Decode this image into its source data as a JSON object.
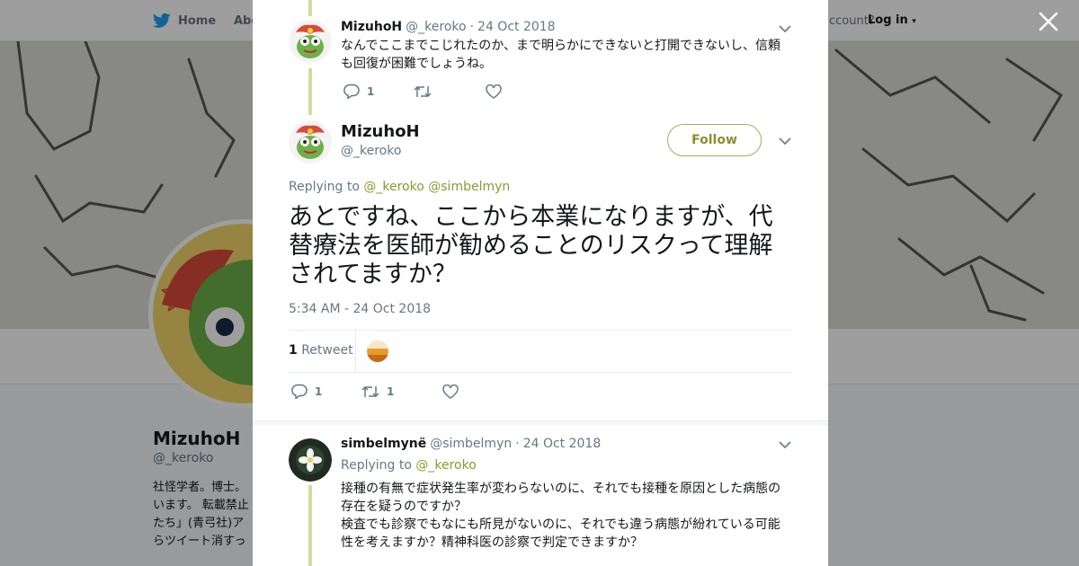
{
  "background": {
    "nav": {
      "home_label": "Home",
      "about_label": "Abo",
      "account_text": "ccount?",
      "login_label": "Log in"
    },
    "profile": {
      "name": "MizuhoH",
      "handle": "@_keroko",
      "bio": "社怪学者。博士。\nいます。 転載禁止\nたち」(青弓社)ア\nらツイート消すっ"
    }
  },
  "modal": {
    "parent_tweet": {
      "name": "MizuhoH",
      "handle": "@_keroko",
      "date": "24 Oct 2018",
      "text": "なんでここまでこじれたのか、まで明らかにできないと打開できないし、信頼も回復が困難でしょうね。",
      "reply_count": "1",
      "retweet_count": "",
      "like_count": ""
    },
    "main_tweet": {
      "name": "MizuhoH",
      "handle": "@_keroko",
      "follow_label": "Follow",
      "replying_prefix": "Replying to",
      "replying_to": [
        "@_keroko",
        "@simbelmyn"
      ],
      "text": "あとですね、ここから本業になりますが、代替療法を医師が勧めることのリスクって理解されてますか？",
      "timestamp": "5:34 AM - 24 Oct 2018",
      "retweets_number": "1",
      "retweets_label": "Retweet",
      "reply_count": "1",
      "retweet_count": "1",
      "like_count": ""
    },
    "reply_tweet": {
      "name": "simbelmynë",
      "handle": "@simbelmyn",
      "date": "24 Oct 2018",
      "replying_prefix": "Replying to",
      "replying_to": "@_keroko",
      "text_line1": "接種の有無で症状発生率が変わらないのに、それでも接種を原因とした病態の存在を疑うのですか？",
      "text_line2": "検査でも診察でもなにも所見がないのに、それでも違う病態が紛れている可能性を考えますか？精神科医の診察で判定できますか？"
    }
  },
  "icons": [
    "twitter-bird-icon",
    "close-icon",
    "chevron-down-icon",
    "reply-icon",
    "retweet-icon",
    "like-icon"
  ],
  "colors": {
    "accent": "#8a9a2e",
    "thread_line": "#d3dc9f",
    "follow_border": "#a7ab5b",
    "twitter_blue": "#1da1f2"
  }
}
